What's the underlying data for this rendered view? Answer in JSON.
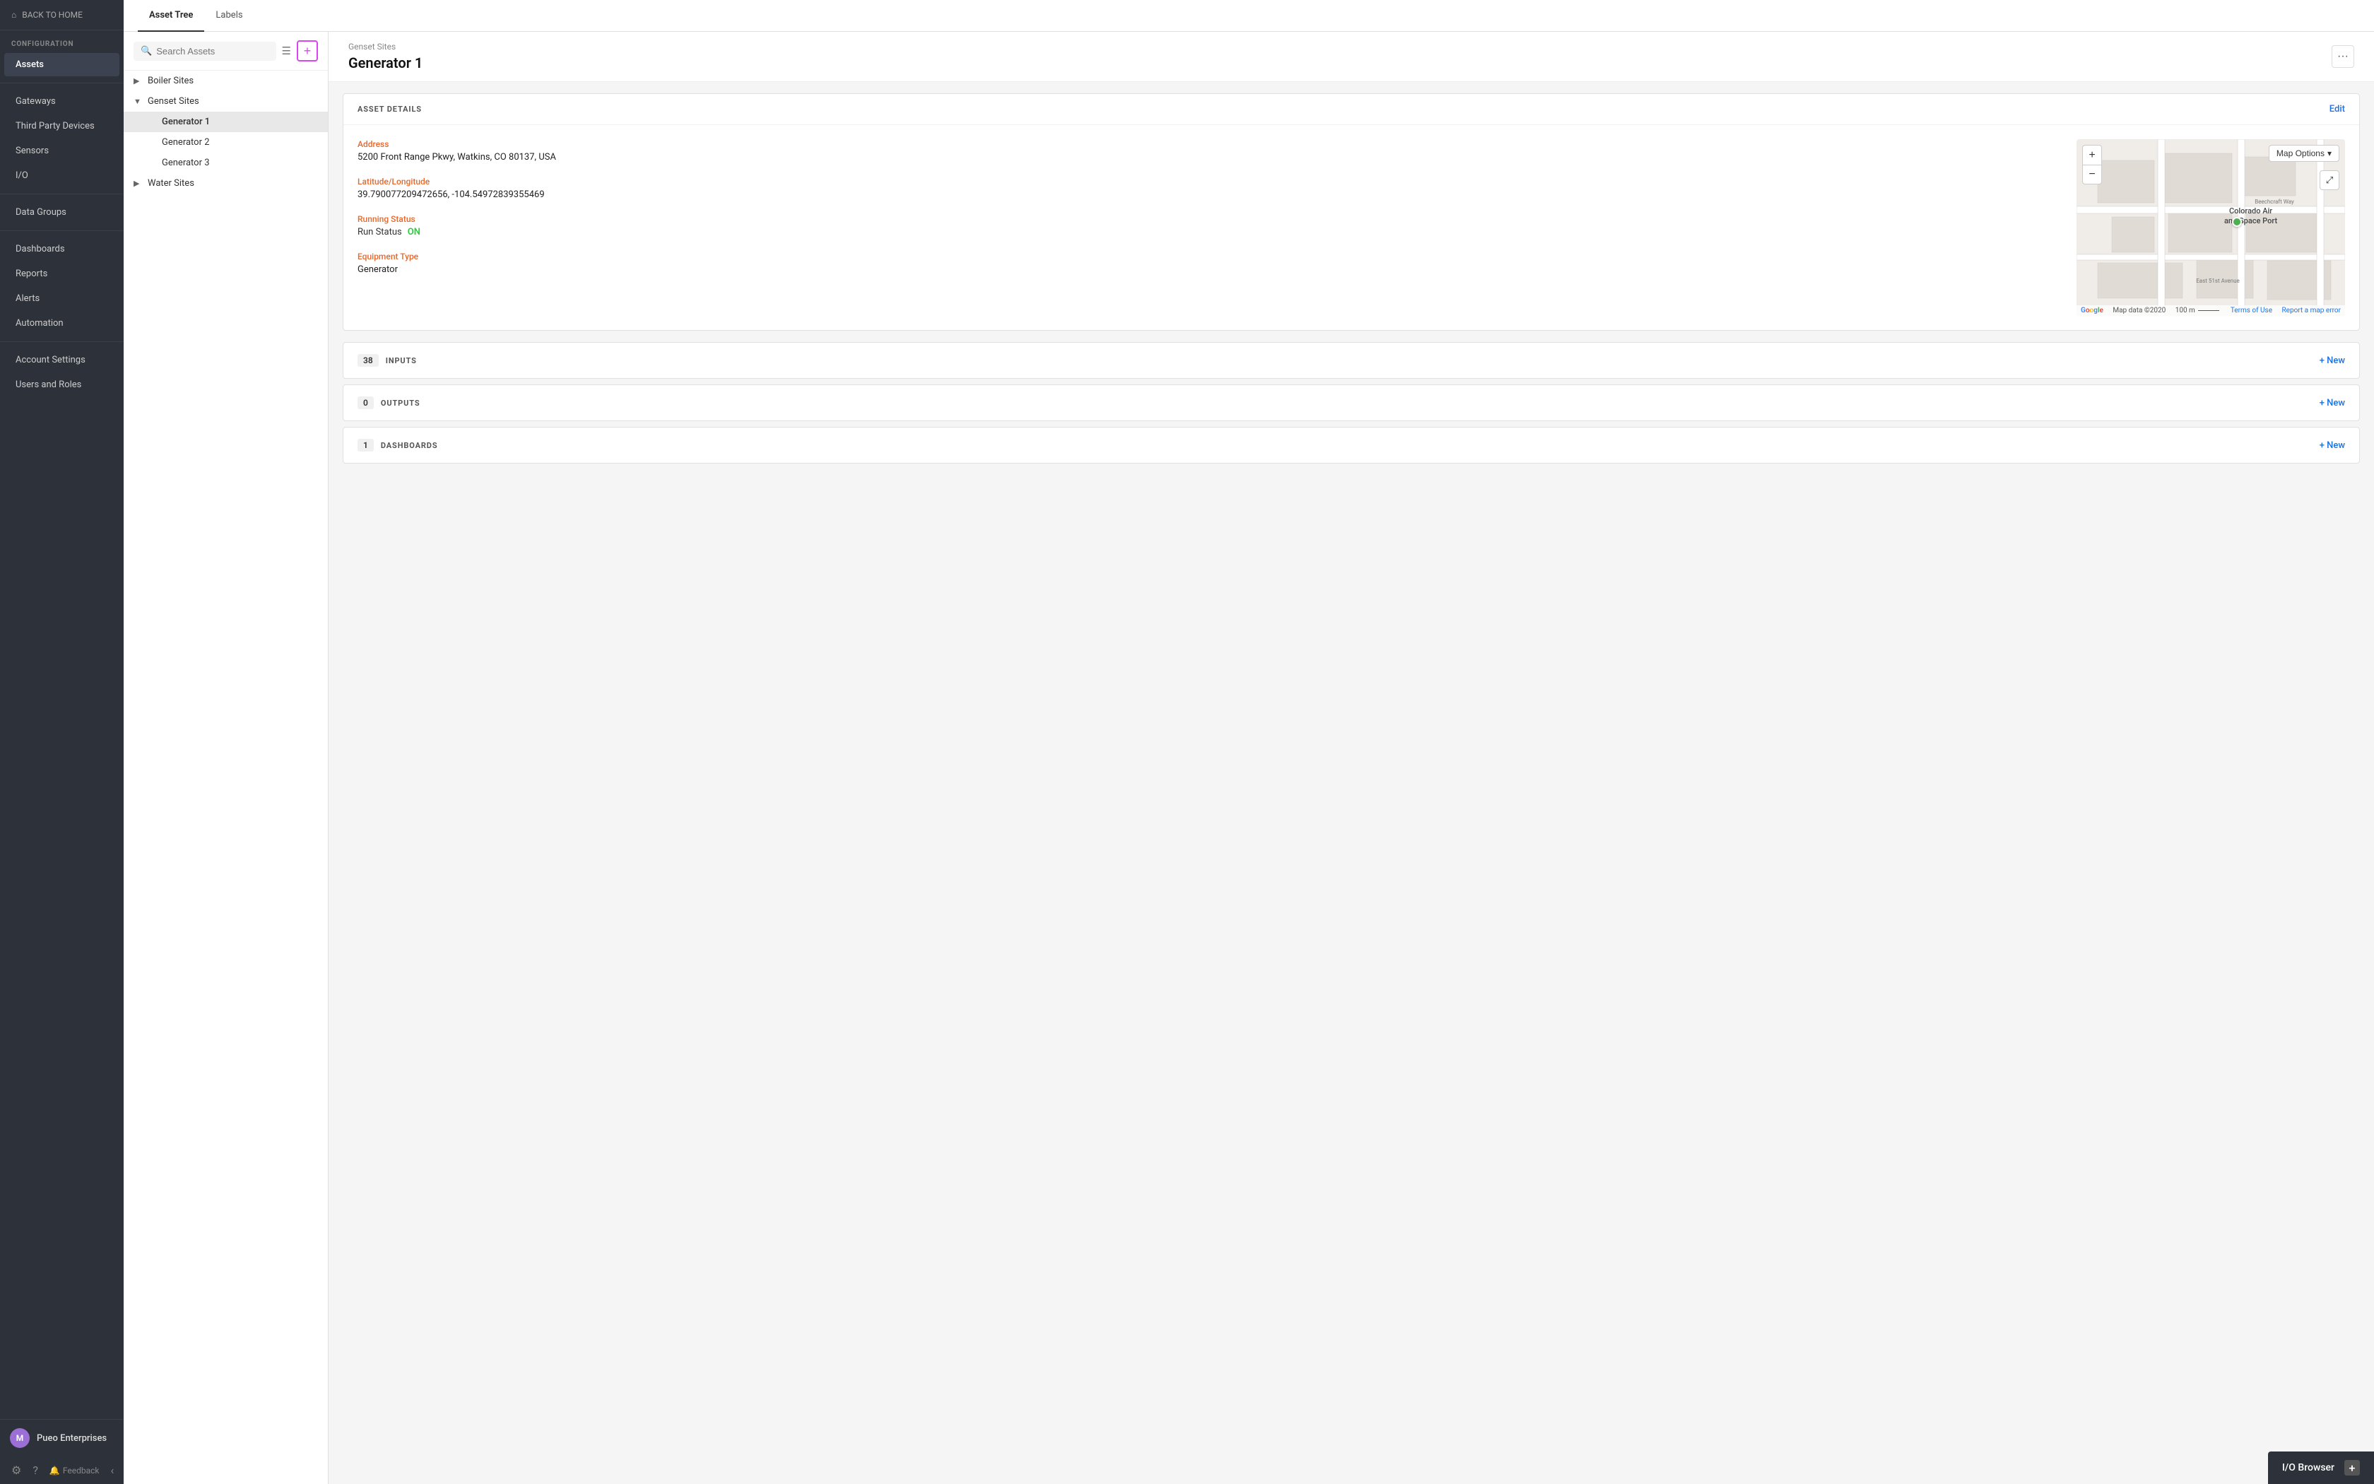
{
  "sidebar": {
    "back_label": "BACK TO HOME",
    "section_label": "CONFIGURATION",
    "items": [
      {
        "id": "assets",
        "label": "Assets",
        "active": true
      },
      {
        "id": "gateways",
        "label": "Gateways"
      },
      {
        "id": "third-party-devices",
        "label": "Third Party Devices"
      },
      {
        "id": "sensors",
        "label": "Sensors"
      },
      {
        "id": "io",
        "label": "I/O"
      },
      {
        "id": "data-groups",
        "label": "Data Groups"
      },
      {
        "id": "dashboards",
        "label": "Dashboards"
      },
      {
        "id": "reports",
        "label": "Reports"
      },
      {
        "id": "alerts",
        "label": "Alerts"
      },
      {
        "id": "automation",
        "label": "Automation"
      },
      {
        "id": "account-settings",
        "label": "Account Settings"
      },
      {
        "id": "users-and-roles",
        "label": "Users and Roles"
      }
    ],
    "user": {
      "name": "Pueo Enterprises",
      "avatar_initial": "M"
    },
    "feedback_label": "Feedback"
  },
  "top_nav": {
    "tabs": [
      {
        "id": "asset-tree",
        "label": "Asset Tree",
        "active": true
      },
      {
        "id": "labels",
        "label": "Labels"
      }
    ]
  },
  "asset_tree": {
    "search_placeholder": "Search Assets",
    "nodes": [
      {
        "id": "boiler-sites",
        "label": "Boiler Sites",
        "expanded": false,
        "children": []
      },
      {
        "id": "genset-sites",
        "label": "Genset Sites",
        "expanded": true,
        "children": [
          {
            "id": "generator-1",
            "label": "Generator 1",
            "selected": true
          },
          {
            "id": "generator-2",
            "label": "Generator 2"
          },
          {
            "id": "generator-3",
            "label": "Generator 3"
          }
        ]
      },
      {
        "id": "water-sites",
        "label": "Water Sites",
        "expanded": false,
        "children": []
      }
    ]
  },
  "detail": {
    "breadcrumb": "Genset Sites",
    "title": "Generator 1",
    "more_button": "···",
    "asset_details_label": "ASSET DETAILS",
    "edit_label": "Edit",
    "fields": {
      "address_label": "Address",
      "address_value": "5200 Front Range Pkwy, Watkins, CO 80137, USA",
      "lat_lon_label": "Latitude/Longitude",
      "lat_lon_value": "39.790077209472656, -104.54972839355469",
      "running_status_label": "Running Status",
      "run_status_key": "Run Status",
      "run_status_value": "ON",
      "equipment_type_label": "Equipment Type",
      "equipment_type_value": "Generator"
    },
    "map": {
      "options_label": "Map Options",
      "zoom_in": "+",
      "zoom_out": "−",
      "place_name": "Colorado Air\nand Space Port",
      "road_label": "Beechcraft Way",
      "road_label2": "East 51st Avenue",
      "footer_copyright": "Map data ©2020",
      "footer_scale": "100 m",
      "footer_terms": "Terms of Use",
      "footer_report": "Report a map error",
      "footer_google": "Google"
    },
    "sections": [
      {
        "id": "inputs",
        "count": "38",
        "label": "INPUTS",
        "new_label": "+ New"
      },
      {
        "id": "outputs",
        "count": "0",
        "label": "OUTPUTS",
        "new_label": "+ New"
      },
      {
        "id": "dashboards",
        "count": "1",
        "label": "DASHBOARDS",
        "new_label": "+ New"
      }
    ]
  },
  "io_browser": {
    "label": "I/O Browser",
    "plus": "+"
  }
}
